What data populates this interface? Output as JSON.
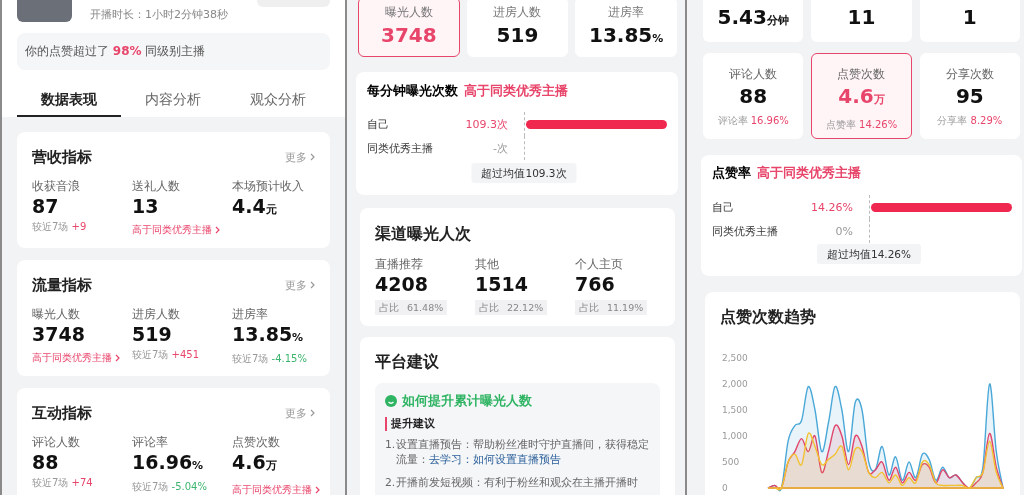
{
  "left": {
    "duration": "开播时长：1小时2分钟38秒",
    "tip": "你的点赞超过了 **98%** 同级别主播",
    "tabs": [
      {
        "label": "数据表现",
        "selected": true
      },
      {
        "label": "内容分析",
        "selected": false
      },
      {
        "label": "观众分析",
        "selected": false
      }
    ],
    "sections": [
      {
        "title": "营收指标",
        "more": "更多",
        "metrics": [
          {
            "label": "收获音浪",
            "value": "87",
            "note": {
              "kind": "compare",
              "label": "较近7场",
              "value": "+9",
              "rising": true
            }
          },
          {
            "label": "送礼人数",
            "value": "13",
            "note": {
              "kind": "link",
              "text": "高于同类优秀主播"
            }
          },
          {
            "label": "本场预计收入",
            "value": "4.4",
            "unit": "元"
          }
        ]
      },
      {
        "title": "流量指标",
        "more": "更多",
        "metrics": [
          {
            "label": "曝光人数",
            "value": "3748",
            "note": {
              "kind": "link",
              "text": "高于同类优秀主播"
            }
          },
          {
            "label": "进房人数",
            "value": "519",
            "note": {
              "kind": "compare",
              "label": "较近7场",
              "value": "+451",
              "rising": true
            }
          },
          {
            "label": "进房率",
            "value": "13.85",
            "unit": "%",
            "note": {
              "kind": "compare",
              "label": "较近7场",
              "value": "-4.15%",
              "rising": false
            }
          }
        ]
      },
      {
        "title": "互动指标",
        "more": "更多",
        "metrics": [
          {
            "label": "评论人数",
            "value": "88",
            "note": {
              "kind": "compare",
              "label": "较近7场",
              "value": "+74",
              "rising": true
            }
          },
          {
            "label": "评论率",
            "value": "16.96",
            "unit": "%",
            "note": {
              "kind": "compare",
              "label": "较近7场",
              "value": "-5.04%",
              "rising": false
            }
          },
          {
            "label": "点赞次数",
            "value": "4.6",
            "unit": "万",
            "note": {
              "kind": "link",
              "text": "高于同类优秀主播"
            }
          }
        ]
      }
    ]
  },
  "middle": {
    "tiles": [
      {
        "label": "曝光人数",
        "value": "3748",
        "selected": true
      },
      {
        "label": "进房人数",
        "value": "519",
        "selected": false
      },
      {
        "label": "进房率",
        "value": "13.85",
        "unit": "%",
        "selected": false
      }
    ],
    "comparison": {
      "title": "每分钟曝光次数",
      "verdict": "高于同类优秀主播",
      "rows": [
        {
          "label": "自己",
          "reading": "109.3次",
          "level": 1
        },
        {
          "label": "同类优秀主播",
          "reading": "-次"
        }
      ],
      "summary": "超过均值109.3次"
    },
    "channels": {
      "title": "渠道曝光人次",
      "items": [
        {
          "label": "直播推荐",
          "value": "4208",
          "share_label": "占比",
          "share": "61.48%"
        },
        {
          "label": "其他",
          "value": "1514",
          "share_label": "占比",
          "share": "22.12%"
        },
        {
          "label": "个人主页",
          "value": "766",
          "share_label": "占比",
          "share": "11.19%"
        }
      ]
    },
    "advice": {
      "title": "平台建议",
      "topic": "如何提升累计曝光人数",
      "subtitle": "提升建议",
      "items": [
        {
          "number": "1.",
          "text": "设置直播预告：帮助粉丝准时守护直播间，获得稳定流量：",
          "link": "去学习：如何设置直播预告"
        },
        {
          "number": "2.",
          "text": "开播前发短视频：有利于粉丝和观众在主播开播时"
        }
      ]
    }
  },
  "right": {
    "top_tiles": [
      {
        "value": "5.43",
        "unit": "分钟"
      },
      {
        "value": "11"
      },
      {
        "value": "1"
      }
    ],
    "tiles": [
      {
        "label": "评论人数",
        "value": "88",
        "rate_label": "评论率",
        "rate": "16.96%",
        "selected": false
      },
      {
        "label": "点赞次数",
        "value": "4.6",
        "unit": "万",
        "rate_label": "点赞率",
        "rate": "14.26%",
        "selected": true
      },
      {
        "label": "分享次数",
        "value": "95",
        "rate_label": "分享率",
        "rate": "8.29%",
        "selected": false
      }
    ],
    "comparison": {
      "title": "点赞率",
      "verdict": "高于同类优秀主播",
      "rows": [
        {
          "label": "自己",
          "reading": "14.26%",
          "level": 1
        },
        {
          "label": "同类优秀主播",
          "reading": "0%"
        }
      ],
      "summary": "超过均值14.26%"
    },
    "trend": {
      "title": "点赞次数趋势",
      "chart_data": {
        "type": "area",
        "ylim": [
          0,
          2500
        ],
        "yticks": [
          {
            "value": 0,
            "label": "0"
          },
          {
            "value": 500,
            "label": "500"
          },
          {
            "value": 1000,
            "label": "1,000"
          },
          {
            "value": 1500,
            "label": "1,500"
          },
          {
            "value": 2000,
            "label": "2,000"
          },
          {
            "value": 2500,
            "label": "2,500"
          }
        ],
        "series": [
          {
            "color": "#4aa8d8",
            "values": [
              0,
              50,
              0,
              900,
              1200,
              1300,
              1950,
              1500,
              700,
              1250,
              1950,
              1500,
              700,
              1650,
              1500,
              500,
              350,
              800,
              250,
              600,
              150,
              500,
              200,
              650,
              550,
              150,
              400,
              200,
              250,
              100,
              0,
              200,
              400,
              2000,
              700,
              0
            ]
          },
          {
            "color": "#e0446a",
            "values": [
              0,
              50,
              0,
              500,
              700,
              950,
              700,
              1000,
              300,
              700,
              1200,
              1000,
              450,
              1000,
              800,
              300,
              350,
              500,
              150,
              400,
              100,
              300,
              150,
              450,
              400,
              100,
              350,
              200,
              250,
              100,
              0,
              100,
              300,
              1050,
              400,
              0
            ]
          },
          {
            "color": "#f2c230",
            "values": [
              0,
              0,
              0,
              500,
              650,
              450,
              1050,
              800,
              450,
              550,
              650,
              800,
              350,
              750,
              700,
              300,
              200,
              300,
              100,
              250,
              50,
              200,
              100,
              500,
              450,
              100,
              50,
              50,
              50,
              50,
              0,
              200,
              300,
              900,
              300,
              0
            ]
          }
        ]
      }
    }
  }
}
